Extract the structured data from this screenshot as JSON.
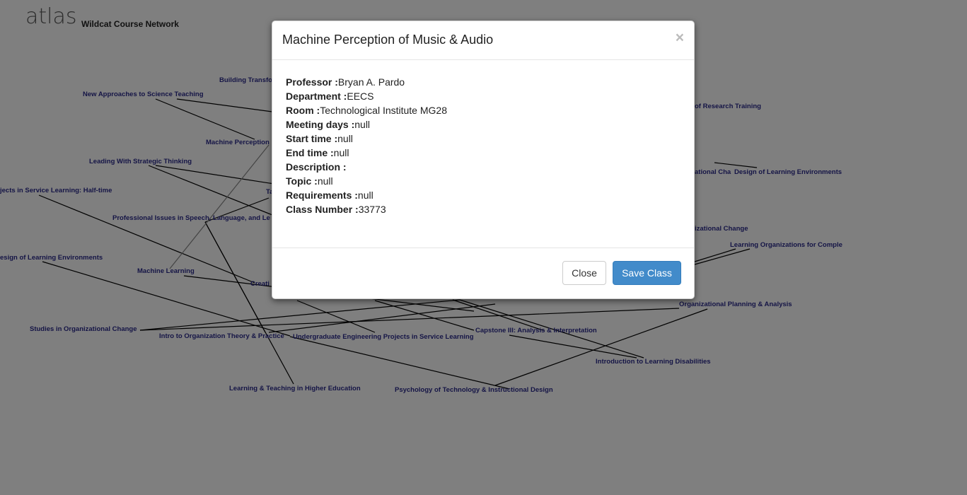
{
  "header": {
    "brand": "atlas",
    "network_title": "Wildcat Course Network"
  },
  "graph": {
    "nodes": [
      {
        "id": "building-transf",
        "label": "Building Transfo"
      },
      {
        "id": "new-approaches",
        "label": "New Approaches to Science Teaching"
      },
      {
        "id": "machine-perception",
        "label": "Machine Perception"
      },
      {
        "id": "leading-strategic",
        "label": "Leading With Strategic Thinking"
      },
      {
        "id": "projects-service-halftime",
        "label": "jects in Service Learning: Half-time"
      },
      {
        "id": "ta-partial",
        "label": "Ta"
      },
      {
        "id": "professional-issues",
        "label": "Professional Issues in Speech, Language, and Le"
      },
      {
        "id": "design-learning-left",
        "label": "esign of Learning Environments"
      },
      {
        "id": "machine-learning",
        "label": "Machine Learning"
      },
      {
        "id": "creati",
        "label": "Creati"
      },
      {
        "id": "studies-org-change",
        "label": "Studies in Organizational Change"
      },
      {
        "id": "intro-org-theory",
        "label": "Intro to Organization Theory & Practice"
      },
      {
        "id": "undergrad-eng",
        "label": "Undergraduate Engineering Projects in Service Learning"
      },
      {
        "id": "capstone-iii",
        "label": "Capstone III: Analysis & Interpretation"
      },
      {
        "id": "learning-teaching-higher",
        "label": "Learning & Teaching in Higher Education"
      },
      {
        "id": "psych-tech",
        "label": "Psychology of Technology & Instructional Design"
      },
      {
        "id": "intro-learning-disab",
        "label": "Introduction to Learning Disabilities"
      },
      {
        "id": "org-planning",
        "label": "Organizational Planning & Analysis"
      },
      {
        "id": "research-training",
        "label": "of Research Training"
      },
      {
        "id": "org-cha",
        "label": "ational Cha"
      },
      {
        "id": "design-learning-right",
        "label": "Design of Learning Environments"
      },
      {
        "id": "izational-change",
        "label": "izational Change"
      },
      {
        "id": "learning-orgs-complex",
        "label": "Learning Organizations for Comple"
      }
    ]
  },
  "modal": {
    "title": "Machine Perception of Music & Audio",
    "close_symbol": "×",
    "fields": [
      {
        "label": "Professor :",
        "value": "Bryan A. Pardo"
      },
      {
        "label": "Department :",
        "value": "EECS"
      },
      {
        "label": "Room :",
        "value": "Technological Institute MG28"
      },
      {
        "label": "Meeting days :",
        "value": "null"
      },
      {
        "label": "Start time :",
        "value": "null"
      },
      {
        "label": "End time :",
        "value": "null"
      },
      {
        "label": "Description :",
        "value": ""
      },
      {
        "label": "Topic :",
        "value": "null"
      },
      {
        "label": "Requirements :",
        "value": "null"
      },
      {
        "label": "Class Number :",
        "value": "33773"
      }
    ],
    "close_button": "Close",
    "save_button": "Save Class"
  }
}
